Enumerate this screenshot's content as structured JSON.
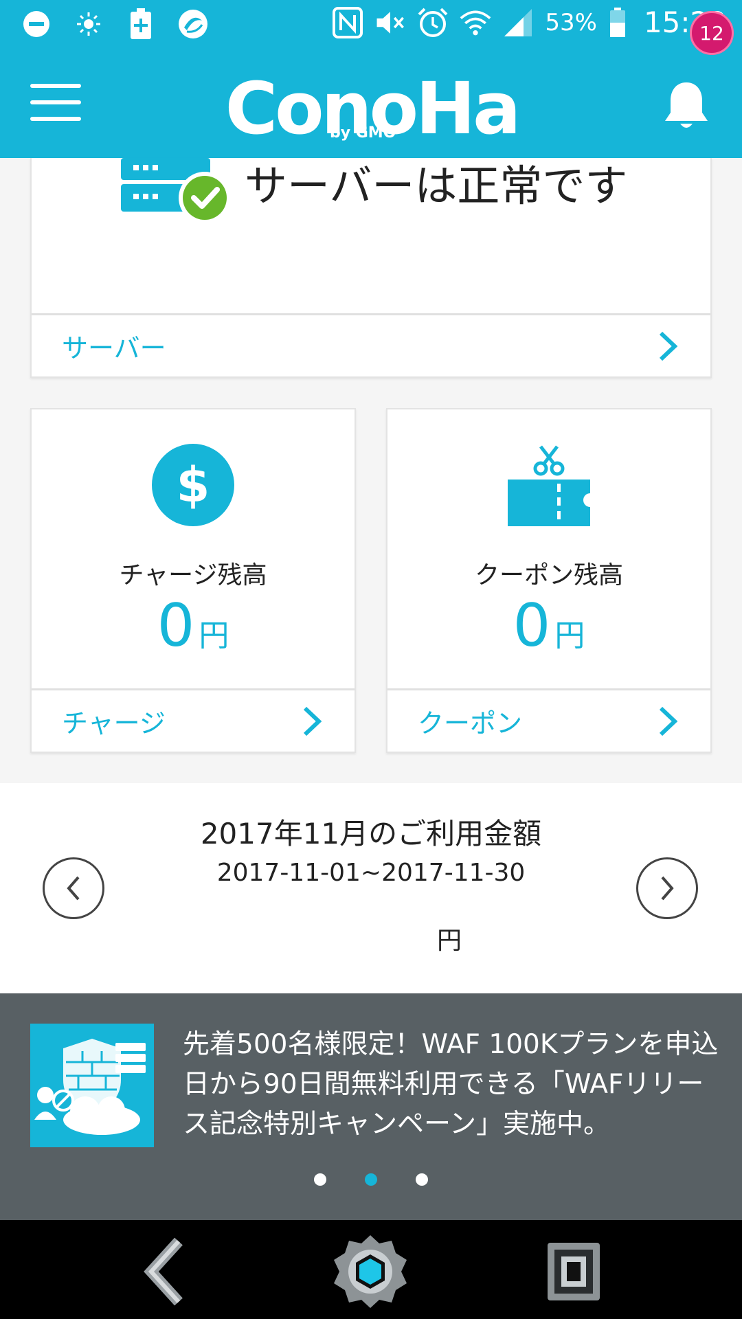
{
  "status_bar": {
    "battery_percent": "53%",
    "time": "15:22",
    "icons": [
      "minus-circle-icon",
      "brightness-icon",
      "battery-charge-icon",
      "app-circle-icon",
      "nfc-icon",
      "mute-icon",
      "alarm-icon",
      "wifi-icon",
      "signal-icon",
      "battery-icon"
    ]
  },
  "app_bar": {
    "logo_main": "ConoHa",
    "logo_sub": "by GMO",
    "notification_count": "12"
  },
  "server_card": {
    "status_text": "サーバーは正常です",
    "link_label": "サーバー"
  },
  "charge_card": {
    "label": "チャージ残高",
    "amount": "0",
    "unit": "円",
    "link_label": "チャージ"
  },
  "coupon_card": {
    "label": "クーポン残高",
    "amount": "0",
    "unit": "円",
    "link_label": "クーポン"
  },
  "usage": {
    "title": "2017年11月のご利用金額",
    "range": "2017-11-01~2017-11-30",
    "unit": "円"
  },
  "banner": {
    "text": "先着500名様限定！WAF 100Kプランを申込日から90日間無料利用できる「WAFリリース記念特別キャンペーン」実施中。",
    "dots_total": 3,
    "active_dot": 2
  },
  "colors": {
    "accent": "#16b5d8",
    "badge": "#d41a6e",
    "success": "#67b72b",
    "banner_bg": "#586064"
  }
}
